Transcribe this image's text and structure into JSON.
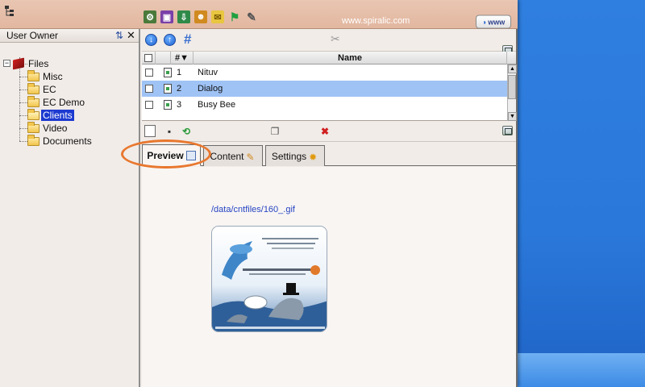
{
  "window": {
    "site_url": "www.spiralic.com",
    "www_button": "www"
  },
  "toolbar": {
    "icons": [
      "settings-icon",
      "book-icon",
      "export-icon",
      "users-icon",
      "mail-icon",
      "flag-icon",
      "tools-icon"
    ]
  },
  "left_panel": {
    "title": "User Owner",
    "tree": {
      "root": "Files",
      "children": [
        {
          "label": "Misc",
          "selected": false
        },
        {
          "label": "EC",
          "selected": false
        },
        {
          "label": "EC Demo",
          "selected": false
        },
        {
          "label": "Clients",
          "selected": true
        },
        {
          "label": "Video",
          "selected": false
        },
        {
          "label": "Documents",
          "selected": false
        }
      ]
    }
  },
  "grid": {
    "columns": {
      "num": "#▼",
      "name": "Name"
    },
    "rows": [
      {
        "num": "1",
        "name": "Nituv",
        "selected": false
      },
      {
        "num": "2",
        "name": "Dialog",
        "selected": true
      },
      {
        "num": "3",
        "name": "Busy Bee",
        "selected": false
      }
    ]
  },
  "tabs": [
    {
      "label": "Preview",
      "active": true
    },
    {
      "label": "Content",
      "active": false
    },
    {
      "label": "Settings",
      "active": false
    }
  ],
  "preview": {
    "file_path": "/data/cntfiles/160_.gif"
  },
  "colors": {
    "selection": "#9fc3f5",
    "tree_selection": "#1d3ad0",
    "highlight_ring": "#e8772e",
    "titlebar": "#e2b7a0"
  }
}
